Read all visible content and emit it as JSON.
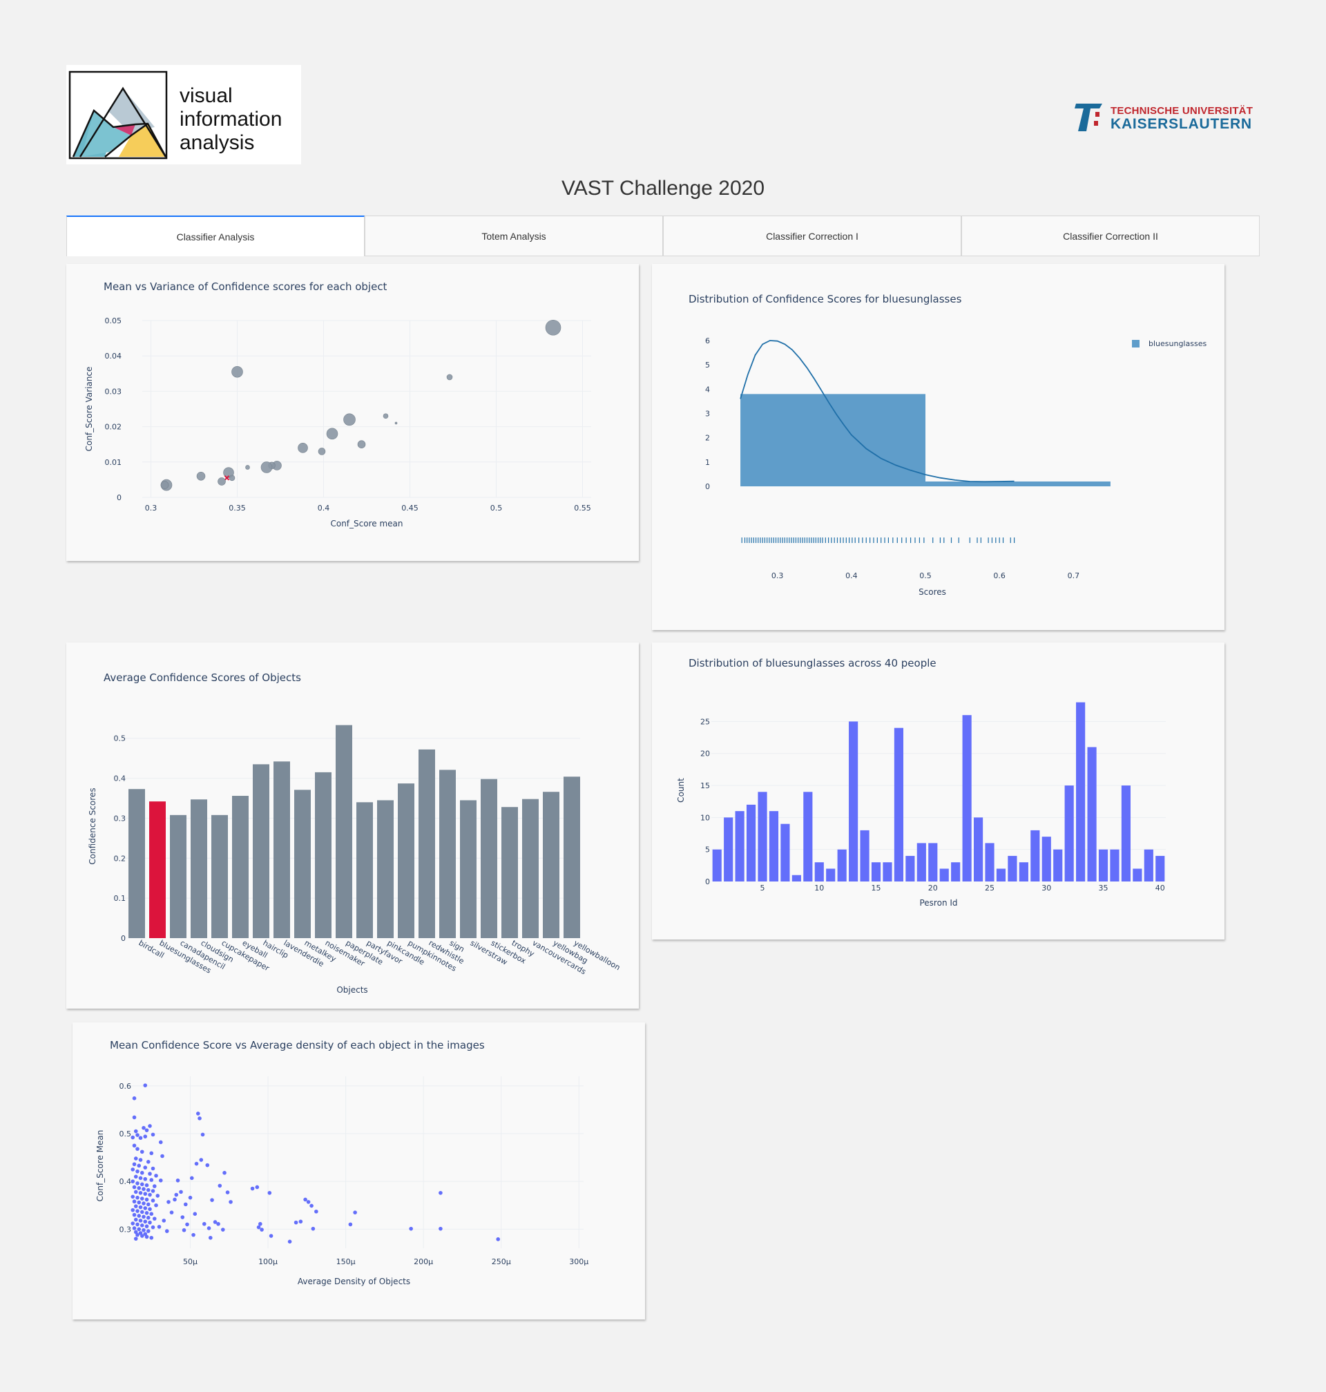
{
  "header": {
    "logo_left_lines": [
      "visual",
      "information",
      "analysis"
    ],
    "logo_right_line1": "TECHNISCHE UNIVERSITÄT",
    "logo_right_line2": "KAISERSLAUTERN",
    "title": "VAST Challenge 2020"
  },
  "tabs": [
    {
      "label": "Classifier Analysis",
      "active": true
    },
    {
      "label": "Totem Analysis",
      "active": false
    },
    {
      "label": "Classifier Correction I",
      "active": false
    },
    {
      "label": "Classifier Correction II",
      "active": false
    }
  ],
  "colors": {
    "bubble": "#8a96a3",
    "bar_gray": "#7b8a98",
    "bar_highlight": "#dc143c",
    "hist_blue": "#5f9dca",
    "kde_line": "#1f6fa8",
    "count_bar": "#636efa",
    "scatter_point": "#636efa"
  },
  "chart_data": [
    {
      "id": "mean-variance",
      "type": "scatter",
      "title": "Mean vs Variance of Confidence scores for each object",
      "xlabel": "Conf_Score mean",
      "ylabel": "Conf_Score Variance",
      "xlim": [
        0.295,
        0.555
      ],
      "ylim": [
        0,
        0.05
      ],
      "xticks": [
        0.3,
        0.35,
        0.4,
        0.45,
        0.5,
        0.55
      ],
      "xtick_labels": [
        "0.3",
        "0.35",
        "0.4",
        "0.45",
        "0.5",
        "0.55"
      ],
      "yticks": [
        0,
        0.01,
        0.02,
        0.03,
        0.04,
        0.05
      ],
      "ytick_labels": [
        "0",
        "0.01",
        "0.02",
        "0.03",
        "0.04",
        "0.05"
      ],
      "points": [
        {
          "x": 0.533,
          "y": 0.048,
          "size": 11,
          "highlight": false
        },
        {
          "x": 0.35,
          "y": 0.0355,
          "size": 8,
          "highlight": false
        },
        {
          "x": 0.473,
          "y": 0.034,
          "size": 4,
          "highlight": false
        },
        {
          "x": 0.436,
          "y": 0.023,
          "size": 3.5,
          "highlight": false
        },
        {
          "x": 0.442,
          "y": 0.021,
          "size": 1.5,
          "highlight": false
        },
        {
          "x": 0.415,
          "y": 0.022,
          "size": 8.5,
          "highlight": false
        },
        {
          "x": 0.405,
          "y": 0.018,
          "size": 8,
          "highlight": false
        },
        {
          "x": 0.388,
          "y": 0.014,
          "size": 7,
          "highlight": false
        },
        {
          "x": 0.422,
          "y": 0.015,
          "size": 5.5,
          "highlight": false
        },
        {
          "x": 0.399,
          "y": 0.013,
          "size": 5,
          "highlight": false
        },
        {
          "x": 0.356,
          "y": 0.0085,
          "size": 3,
          "highlight": false
        },
        {
          "x": 0.373,
          "y": 0.009,
          "size": 6.5,
          "highlight": false
        },
        {
          "x": 0.37,
          "y": 0.009,
          "size": 5,
          "highlight": false
        },
        {
          "x": 0.367,
          "y": 0.0085,
          "size": 8,
          "highlight": false
        },
        {
          "x": 0.345,
          "y": 0.007,
          "size": 7.5,
          "highlight": false
        },
        {
          "x": 0.329,
          "y": 0.006,
          "size": 6,
          "highlight": false
        },
        {
          "x": 0.347,
          "y": 0.0055,
          "size": 4,
          "highlight": false
        },
        {
          "x": 0.344,
          "y": 0.0055,
          "size": 2.5,
          "highlight": true
        },
        {
          "x": 0.341,
          "y": 0.0045,
          "size": 5.5,
          "highlight": false
        },
        {
          "x": 0.309,
          "y": 0.0035,
          "size": 8,
          "highlight": false
        },
        {
          "x": 0.308,
          "y": 0.0035,
          "size": 5.5,
          "highlight": false
        }
      ]
    },
    {
      "id": "bluesunglasses-distribution",
      "type": "bar",
      "title": "Distribution of Confidence Scores for bluesunglasses",
      "xlabel": "Scores",
      "legend": "bluesunglasses",
      "xlim": [
        0.235,
        0.765
      ],
      "ylim": [
        0,
        6.2
      ],
      "xticks": [
        0.3,
        0.4,
        0.5,
        0.6,
        0.7
      ],
      "xtick_labels": [
        "0.3",
        "0.4",
        "0.5",
        "0.6",
        "0.7"
      ],
      "yticks": [
        0,
        1,
        2,
        3,
        4,
        5,
        6
      ],
      "ytick_labels": [
        "0",
        "1",
        "2",
        "3",
        "4",
        "5",
        "6"
      ],
      "bins": [
        {
          "x0": 0.25,
          "x1": 0.5,
          "value": 3.8
        },
        {
          "x0": 0.5,
          "x1": 0.75,
          "value": 0.2
        }
      ],
      "kde": [
        [
          0.25,
          3.6
        ],
        [
          0.26,
          4.6
        ],
        [
          0.27,
          5.4
        ],
        [
          0.28,
          5.85
        ],
        [
          0.29,
          6.0
        ],
        [
          0.3,
          5.98
        ],
        [
          0.31,
          5.85
        ],
        [
          0.32,
          5.62
        ],
        [
          0.33,
          5.28
        ],
        [
          0.34,
          4.88
        ],
        [
          0.35,
          4.42
        ],
        [
          0.36,
          3.92
        ],
        [
          0.37,
          3.42
        ],
        [
          0.38,
          2.95
        ],
        [
          0.39,
          2.52
        ],
        [
          0.4,
          2.12
        ],
        [
          0.42,
          1.55
        ],
        [
          0.44,
          1.15
        ],
        [
          0.46,
          0.87
        ],
        [
          0.48,
          0.66
        ],
        [
          0.5,
          0.48
        ],
        [
          0.52,
          0.35
        ],
        [
          0.54,
          0.26
        ],
        [
          0.56,
          0.2
        ],
        [
          0.58,
          0.19
        ],
        [
          0.6,
          0.2
        ],
        [
          0.62,
          0.21
        ]
      ],
      "rug": [
        0.252,
        0.256,
        0.259,
        0.262,
        0.265,
        0.268,
        0.271,
        0.274,
        0.277,
        0.28,
        0.283,
        0.286,
        0.289,
        0.292,
        0.295,
        0.298,
        0.301,
        0.304,
        0.307,
        0.31,
        0.313,
        0.316,
        0.319,
        0.322,
        0.325,
        0.328,
        0.331,
        0.334,
        0.337,
        0.34,
        0.343,
        0.346,
        0.349,
        0.352,
        0.355,
        0.358,
        0.361,
        0.365,
        0.369,
        0.373,
        0.377,
        0.381,
        0.385,
        0.389,
        0.393,
        0.397,
        0.401,
        0.405,
        0.41,
        0.415,
        0.42,
        0.425,
        0.43,
        0.435,
        0.44,
        0.445,
        0.45,
        0.456,
        0.462,
        0.468,
        0.474,
        0.48,
        0.486,
        0.492,
        0.498,
        0.51,
        0.52,
        0.525,
        0.535,
        0.545,
        0.56,
        0.57,
        0.575,
        0.585,
        0.59,
        0.595,
        0.6,
        0.605,
        0.615,
        0.62
      ]
    },
    {
      "id": "average-confidence",
      "type": "bar",
      "title": "Average Confidence Scores of Objects",
      "xlabel": "Objects",
      "ylabel": "Confidence Scores",
      "ylim": [
        0,
        0.56
      ],
      "yticks": [
        0,
        0.1,
        0.2,
        0.3,
        0.4,
        0.5
      ],
      "ytick_labels": [
        "0",
        "0.1",
        "0.2",
        "0.3",
        "0.4",
        "0.5"
      ],
      "highlight": "bluesunglasses",
      "categories": [
        "birdcall",
        "bluesunglasses",
        "canadapencil",
        "cloudsign",
        "cupcakepaper",
        "eyeball",
        "hairclip",
        "lavenderdie",
        "metalkey",
        "noisemaker",
        "paperplate",
        "partyfavor",
        "pinkcandle",
        "pumpkinnotes",
        "redwhistle",
        "sign",
        "silverstraw",
        "stickerbox",
        "trophy",
        "vancouvercards",
        "yellowbag",
        "yellowballoon"
      ],
      "values": [
        0.373,
        0.342,
        0.308,
        0.347,
        0.308,
        0.356,
        0.435,
        0.442,
        0.371,
        0.415,
        0.533,
        0.34,
        0.345,
        0.387,
        0.472,
        0.421,
        0.345,
        0.398,
        0.328,
        0.348,
        0.366,
        0.404
      ]
    },
    {
      "id": "bluesunglasses-people",
      "type": "bar",
      "title": "Distribution of bluesunglasses across 40 people",
      "xlabel": "Pesron Id",
      "ylabel": "Count",
      "xlim": [
        0.5,
        40.5
      ],
      "ylim": [
        0,
        28.5
      ],
      "xticks": [
        5,
        10,
        15,
        20,
        25,
        30,
        35,
        40
      ],
      "xtick_labels": [
        "5",
        "10",
        "15",
        "20",
        "25",
        "30",
        "35",
        "40"
      ],
      "yticks": [
        0,
        5,
        10,
        15,
        20,
        25
      ],
      "ytick_labels": [
        "0",
        "5",
        "10",
        "15",
        "20",
        "25"
      ],
      "x": [
        1,
        2,
        3,
        4,
        5,
        6,
        7,
        8,
        9,
        10,
        11,
        12,
        13,
        14,
        15,
        16,
        17,
        18,
        19,
        20,
        21,
        22,
        23,
        24,
        25,
        26,
        27,
        28,
        29,
        30,
        31,
        32,
        33,
        34,
        35,
        36,
        37,
        38,
        39,
        40
      ],
      "values": [
        5,
        10,
        11,
        12,
        14,
        11,
        9,
        1,
        14,
        3,
        2,
        5,
        25,
        8,
        3,
        3,
        24,
        4,
        6,
        6,
        2,
        3,
        26,
        10,
        6,
        2,
        4,
        3,
        8,
        7,
        5,
        15,
        28,
        21,
        5,
        5,
        15,
        2,
        5,
        4
      ]
    },
    {
      "id": "density-vs-mean",
      "type": "scatter",
      "title": "Mean Confidence Score vs Average density of each object in the images",
      "xlabel": "Average Density of Objects",
      "ylabel": "Conf_Score Mean",
      "xlim": [
        1.2e-05,
        0.000303
      ],
      "ylim": [
        0.26,
        0.62
      ],
      "xticks": [
        5e-05,
        0.0001,
        0.00015,
        0.0002,
        0.00025,
        0.0003
      ],
      "xtick_labels": [
        "50μ",
        "100μ",
        "150μ",
        "200μ",
        "250μ",
        "300μ"
      ],
      "yticks": [
        0.3,
        0.4,
        0.5,
        0.6
      ],
      "ytick_labels": [
        "0.3",
        "0.4",
        "0.5",
        "0.6"
      ],
      "points": [
        [
          2.1e-05,
          0.601
        ],
        [
          1.4e-05,
          0.574
        ],
        [
          1.4e-05,
          0.534
        ],
        [
          2.4e-05,
          0.516
        ],
        [
          2e-05,
          0.512
        ],
        [
          1.5e-05,
          0.505
        ],
        [
          2.2e-05,
          0.507
        ],
        [
          1.6e-05,
          0.497
        ],
        [
          2.1e-05,
          0.494
        ],
        [
          1.8e-05,
          0.491
        ],
        [
          1.3e-05,
          0.492
        ],
        [
          2.6e-05,
          0.498
        ],
        [
          3.1e-05,
          0.482
        ],
        [
          1.4e-05,
          0.475
        ],
        [
          1.6e-05,
          0.468
        ],
        [
          1.9e-05,
          0.462
        ],
        [
          2.5e-05,
          0.459
        ],
        [
          3.2e-05,
          0.453
        ],
        [
          1.5e-05,
          0.448
        ],
        [
          1.8e-05,
          0.445
        ],
        [
          2.3e-05,
          0.441
        ],
        [
          1.4e-05,
          0.436
        ],
        [
          1.7e-05,
          0.433
        ],
        [
          2.1e-05,
          0.429
        ],
        [
          2.6e-05,
          0.427
        ],
        [
          1.3e-05,
          0.425
        ],
        [
          1.6e-05,
          0.421
        ],
        [
          1.9e-05,
          0.418
        ],
        [
          2.4e-05,
          0.416
        ],
        [
          2.8e-05,
          0.412
        ],
        [
          1.5e-05,
          0.41
        ],
        [
          1.8e-05,
          0.407
        ],
        [
          2.1e-05,
          0.405
        ],
        [
          2.5e-05,
          0.403
        ],
        [
          3.1e-05,
          0.402
        ],
        [
          1.3e-05,
          0.4
        ],
        [
          1.6e-05,
          0.396
        ],
        [
          1.9e-05,
          0.394
        ],
        [
          2.2e-05,
          0.392
        ],
        [
          2.7e-05,
          0.39
        ],
        [
          1.4e-05,
          0.388
        ],
        [
          1.7e-05,
          0.386
        ],
        [
          2e-05,
          0.384
        ],
        [
          2.3e-05,
          0.382
        ],
        [
          2.6e-05,
          0.38
        ],
        [
          1.5e-05,
          0.378
        ],
        [
          1.8e-05,
          0.376
        ],
        [
          2.1e-05,
          0.374
        ],
        [
          2.4e-05,
          0.372
        ],
        [
          2.9e-05,
          0.37
        ],
        [
          1.3e-05,
          0.368
        ],
        [
          1.6e-05,
          0.366
        ],
        [
          1.9e-05,
          0.364
        ],
        [
          2.2e-05,
          0.362
        ],
        [
          2.6e-05,
          0.36
        ],
        [
          1.4e-05,
          0.358
        ],
        [
          1.7e-05,
          0.356
        ],
        [
          2e-05,
          0.354
        ],
        [
          2.3e-05,
          0.352
        ],
        [
          2.8e-05,
          0.35
        ],
        [
          1.5e-05,
          0.348
        ],
        [
          1.8e-05,
          0.346
        ],
        [
          2.1e-05,
          0.344
        ],
        [
          2.4e-05,
          0.342
        ],
        [
          1.3e-05,
          0.34
        ],
        [
          1.6e-05,
          0.338
        ],
        [
          1.9e-05,
          0.336
        ],
        [
          2.2e-05,
          0.334
        ],
        [
          2.5e-05,
          0.332
        ],
        [
          1.4e-05,
          0.33
        ],
        [
          1.7e-05,
          0.328
        ],
        [
          2e-05,
          0.326
        ],
        [
          2.3e-05,
          0.324
        ],
        [
          2.7e-05,
          0.322
        ],
        [
          1.5e-05,
          0.32
        ],
        [
          1.8e-05,
          0.318
        ],
        [
          2.1e-05,
          0.316
        ],
        [
          2.4e-05,
          0.314
        ],
        [
          1.3e-05,
          0.312
        ],
        [
          1.6e-05,
          0.31
        ],
        [
          1.9e-05,
          0.308
        ],
        [
          2.2e-05,
          0.306
        ],
        [
          2.6e-05,
          0.304
        ],
        [
          1.4e-05,
          0.302
        ],
        [
          1.7e-05,
          0.3
        ],
        [
          2e-05,
          0.298
        ],
        [
          2.3e-05,
          0.296
        ],
        [
          1.5e-05,
          0.294
        ],
        [
          1.8e-05,
          0.292
        ],
        [
          2.1e-05,
          0.29
        ],
        [
          1.6e-05,
          0.288
        ],
        [
          1.9e-05,
          0.286
        ],
        [
          2.2e-05,
          0.284
        ],
        [
          1.5e-05,
          0.28
        ],
        [
          2.5e-05,
          0.282
        ],
        [
          3e-05,
          0.305
        ],
        [
          3.3e-05,
          0.318
        ],
        [
          3.5e-05,
          0.296
        ],
        [
          3.6e-05,
          0.357
        ],
        [
          3.8e-05,
          0.335
        ],
        [
          4e-05,
          0.362
        ],
        [
          4.1e-05,
          0.372
        ],
        [
          4.2e-05,
          0.402
        ],
        [
          4.4e-05,
          0.378
        ],
        [
          4.5e-05,
          0.325
        ],
        [
          4.6e-05,
          0.298
        ],
        [
          4.7e-05,
          0.352
        ],
        [
          4.8e-05,
          0.31
        ],
        [
          5e-05,
          0.366
        ],
        [
          5.1e-05,
          0.407
        ],
        [
          5.2e-05,
          0.288
        ],
        [
          5.3e-05,
          0.332
        ],
        [
          5.4e-05,
          0.437
        ],
        [
          5.5e-05,
          0.542
        ],
        [
          5.6e-05,
          0.532
        ],
        [
          5.7e-05,
          0.445
        ],
        [
          5.8e-05,
          0.498
        ],
        [
          5.9e-05,
          0.311
        ],
        [
          6.1e-05,
          0.434
        ],
        [
          6.2e-05,
          0.302
        ],
        [
          6.3e-05,
          0.282
        ],
        [
          6.4e-05,
          0.361
        ],
        [
          6.6e-05,
          0.315
        ],
        [
          6.8e-05,
          0.311
        ],
        [
          6.9e-05,
          0.391
        ],
        [
          7.1e-05,
          0.299
        ],
        [
          7.2e-05,
          0.418
        ],
        [
          7.4e-05,
          0.377
        ],
        [
          7.6e-05,
          0.357
        ],
        [
          9e-05,
          0.385
        ],
        [
          9.3e-05,
          0.388
        ],
        [
          9.4e-05,
          0.304
        ],
        [
          9.5e-05,
          0.311
        ],
        [
          9.6e-05,
          0.299
        ],
        [
          0.000101,
          0.376
        ],
        [
          0.000102,
          0.286
        ],
        [
          0.000114,
          0.274
        ],
        [
          0.000118,
          0.314
        ],
        [
          0.000121,
          0.316
        ],
        [
          0.000124,
          0.362
        ],
        [
          0.000126,
          0.357
        ],
        [
          0.000128,
          0.349
        ],
        [
          0.000129,
          0.301
        ],
        [
          0.000131,
          0.337
        ],
        [
          0.000153,
          0.31
        ],
        [
          0.000156,
          0.335
        ],
        [
          0.000192,
          0.301
        ],
        [
          0.000211,
          0.301
        ],
        [
          0.000211,
          0.376
        ],
        [
          0.000248,
          0.279
        ]
      ]
    }
  ]
}
